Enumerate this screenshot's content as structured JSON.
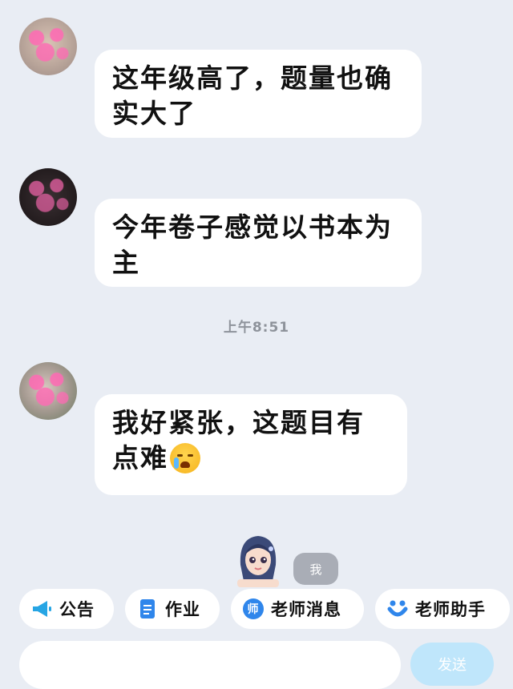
{
  "messages": [
    {
      "text": "这年级高了，题量也确实大了"
    },
    {
      "text": "今年卷子感觉以书本为主"
    },
    {
      "text": "我好紧张，这题目有点难",
      "emoji": "loudly-crying-face"
    }
  ],
  "timestamp": "上午8:51",
  "me_label": "我",
  "shortcuts": [
    {
      "label": "公告",
      "icon": "megaphone-icon"
    },
    {
      "label": "作业",
      "icon": "document-icon"
    },
    {
      "label": "老师消息",
      "icon": "teacher-badge-icon",
      "icon_char": "师"
    },
    {
      "label": "老师助手",
      "icon": "assistant-icon"
    }
  ],
  "send_label": "发送",
  "colors": {
    "background": "#e9edf4",
    "accent": "#1e88e5",
    "send_button": "#bfe6fb"
  }
}
